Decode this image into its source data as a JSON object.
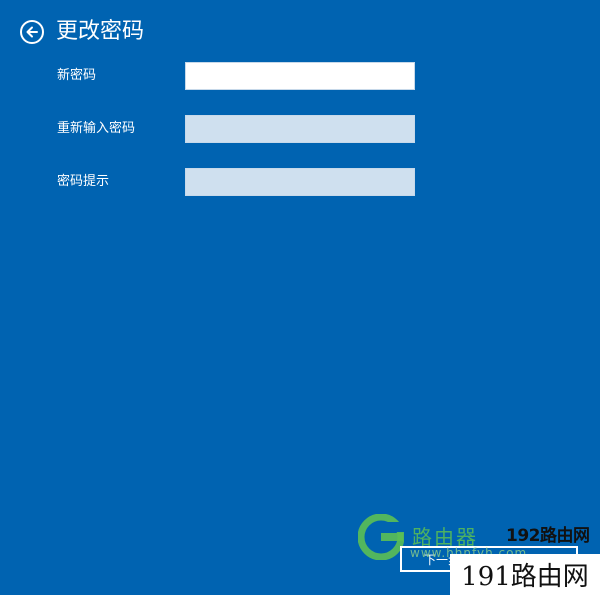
{
  "header": {
    "title": "更改密码",
    "back_icon": "back-arrow-icon"
  },
  "form": {
    "fields": [
      {
        "label": "新密码",
        "value": "",
        "state": "active"
      },
      {
        "label": "重新输入密码",
        "value": "",
        "state": "inactive"
      },
      {
        "label": "密码提示",
        "value": "",
        "state": "inactive"
      }
    ]
  },
  "footer": {
    "next_label": "下一步"
  },
  "watermark": {
    "brand_top": "192路由网",
    "brand_bottom": "191路由网",
    "green_text": "路由器",
    "url_text": "www.hhnfyh.com",
    "logo_color": "#5bbf55"
  },
  "colors": {
    "background": "#0063b1",
    "input_active": "#ffffff",
    "input_inactive": "#cfe0ef"
  }
}
